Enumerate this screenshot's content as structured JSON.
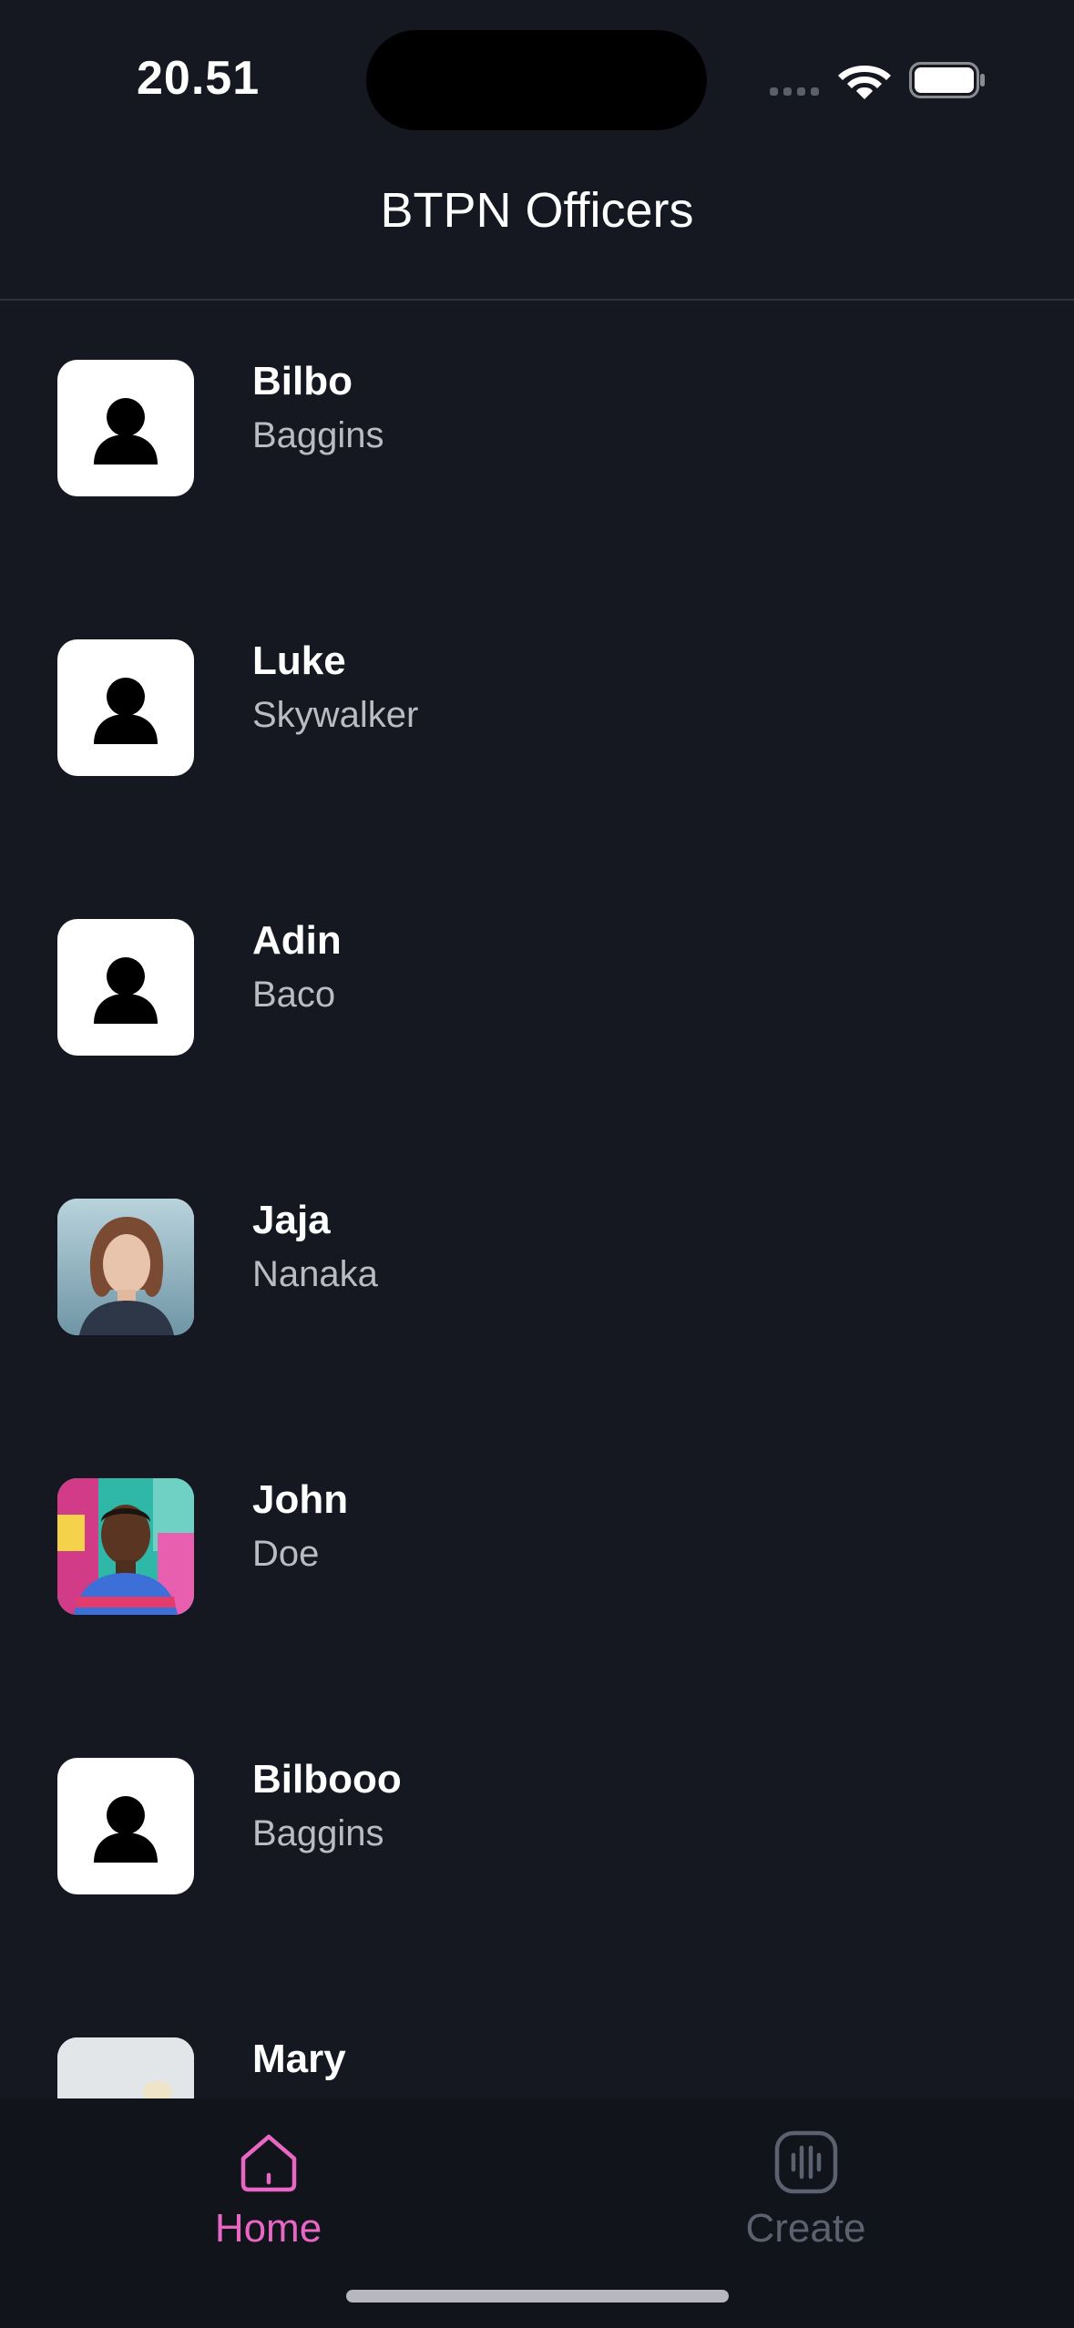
{
  "status_bar": {
    "time": "20.51"
  },
  "header": {
    "title": "BTPN Officers"
  },
  "officers": [
    {
      "first_name": "Bilbo",
      "last_name": "Baggins",
      "avatar": "person-placeholder-icon"
    },
    {
      "first_name": "Luke",
      "last_name": "Skywalker",
      "avatar": "person-placeholder-icon"
    },
    {
      "first_name": "Adin",
      "last_name": "Baco",
      "avatar": "person-placeholder-icon"
    },
    {
      "first_name": "Jaja",
      "last_name": "Nanaka",
      "avatar": "photo"
    },
    {
      "first_name": "John",
      "last_name": "Doe",
      "avatar": "photo"
    },
    {
      "first_name": "Bilbooo",
      "last_name": "Baggins",
      "avatar": "person-placeholder-icon"
    },
    {
      "first_name": "Mary",
      "last_name": "",
      "avatar": "photo"
    }
  ],
  "tab_bar": {
    "home_label": "Home",
    "create_label": "Create",
    "active_color": "#e867c4",
    "inactive_color": "#5b616e"
  }
}
